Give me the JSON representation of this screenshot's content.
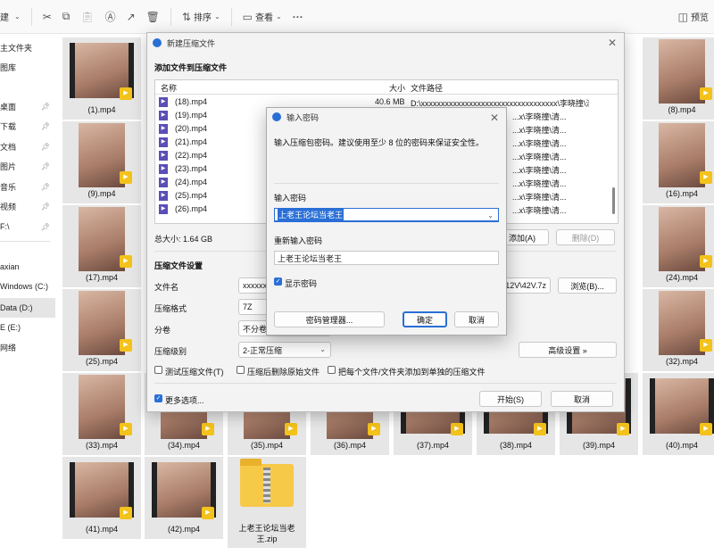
{
  "toolbar": {
    "sort_label": "排序",
    "view_label": "查看",
    "preview_label": "预览",
    "partial_left": "建"
  },
  "sidebar": {
    "items": [
      {
        "label": "主文件夹",
        "pinned": false
      },
      {
        "label": "图库",
        "pinned": false
      },
      {
        "label": "桌面",
        "pinned": true
      },
      {
        "label": "下载",
        "pinned": true
      },
      {
        "label": "文档",
        "pinned": true
      },
      {
        "label": "图片",
        "pinned": true
      },
      {
        "label": "音乐",
        "pinned": true
      },
      {
        "label": "视频",
        "pinned": true
      },
      {
        "label": "F:\\",
        "pinned": true
      },
      {
        "label": "axian",
        "pinned": false
      },
      {
        "label": "Windows (C:)",
        "pinned": false
      },
      {
        "label": "Data (D:)",
        "pinned": false
      },
      {
        "label": "E (E:)",
        "pinned": false
      },
      {
        "label": "网络",
        "pinned": false
      }
    ]
  },
  "player_badge": "Player",
  "files": [
    "(1).mp4",
    "(8).mp4",
    "(9).mp4",
    "(16).mp4",
    "(17).mp4",
    "(24).mp4",
    "(25).mp4",
    "(32).mp4",
    "(33).mp4",
    "(34).mp4",
    "(35).mp4",
    "(36).mp4",
    "(37).mp4",
    "(38).mp4",
    "(39).mp4",
    "(40).mp4",
    "(41).mp4",
    "(42).mp4",
    "上老王论坛当老王.zip"
  ],
  "archive_dialog": {
    "title": "新建压缩文件",
    "add_section": "添加文件到压缩文件",
    "col_name": "名称",
    "col_size": "大小",
    "col_path": "文件路径",
    "rows": [
      {
        "name": "(18).mp4",
        "size": "40.6 MB",
        "path": "D:\\xxxxxxxxxxxxxxxxxxxxxxxxxxxxxxxxxx\\李晓撞\\清..."
      },
      {
        "name": "(19).mp4",
        "size": "",
        "path": "...x\\李晓撞\\清..."
      },
      {
        "name": "(20).mp4",
        "size": "",
        "path": "...x\\李晓撞\\清..."
      },
      {
        "name": "(21).mp4",
        "size": "",
        "path": "...x\\李晓撞\\清..."
      },
      {
        "name": "(22).mp4",
        "size": "",
        "path": "...x\\李晓撞\\清..."
      },
      {
        "name": "(23).mp4",
        "size": "",
        "path": "...x\\李晓撞\\清..."
      },
      {
        "name": "(24).mp4",
        "size": "",
        "path": "...x\\李晓撞\\清..."
      },
      {
        "name": "(25).mp4",
        "size": "",
        "path": "...x\\李晓撞\\清..."
      },
      {
        "name": "(26).mp4",
        "size": "",
        "path": "...x\\李晓撞\\清..."
      }
    ],
    "total_size": "总大小: 1.64 GB",
    "add_button": "添加(A)",
    "delete_button": "删除(D)",
    "settings_section": "压缩文件设置",
    "filename_label": "文件名",
    "filename_value": "xxxxxx",
    "filename_tail": "12V\\42V.7z",
    "browse_button": "浏览(B)...",
    "format_label": "压缩格式",
    "format_value": "7Z",
    "split_label": "分卷",
    "split_value": "不分卷",
    "level_label": "压缩级别",
    "level_value": "2-正常压缩",
    "advanced_button": "高级设置 »",
    "opt_test": "测试压缩文件(T)",
    "opt_delete": "压缩后删除原始文件",
    "opt_each": "把每个文件/文件夹添加到单独的压缩文件",
    "more_options": "更多选项...",
    "start_button": "开始(S)",
    "cancel_button": "取消"
  },
  "password_dialog": {
    "title": "输入密码",
    "hint": "输入压缩包密码。建议使用至少 8 位的密码来保证安全性。",
    "enter_label": "输入密码",
    "enter_value": "上老王论坛当老王",
    "reenter_label": "重新输入密码",
    "reenter_value": "上老王论坛当老王",
    "show_password": "显示密码",
    "manager_button": "密码管理器...",
    "ok_button": "确定",
    "cancel_button": "取消"
  }
}
